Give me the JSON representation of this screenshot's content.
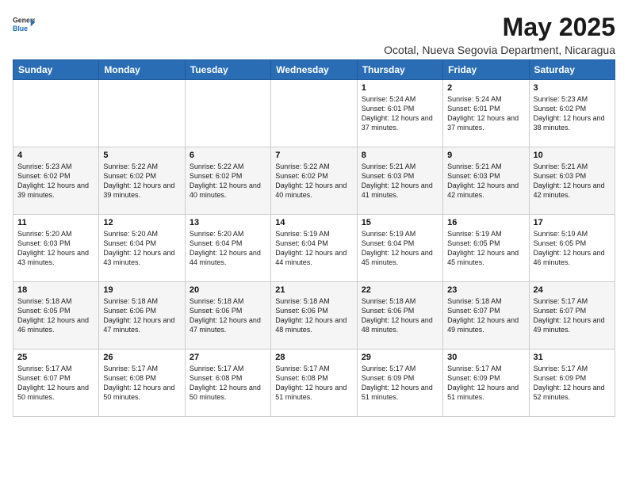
{
  "header": {
    "logo_general": "General",
    "logo_blue": "Blue",
    "title": "May 2025",
    "subtitle": "Ocotal, Nueva Segovia Department, Nicaragua"
  },
  "weekdays": [
    "Sunday",
    "Monday",
    "Tuesday",
    "Wednesday",
    "Thursday",
    "Friday",
    "Saturday"
  ],
  "weeks": [
    [
      {
        "day": "",
        "sunrise": "",
        "sunset": "",
        "daylight": ""
      },
      {
        "day": "",
        "sunrise": "",
        "sunset": "",
        "daylight": ""
      },
      {
        "day": "",
        "sunrise": "",
        "sunset": "",
        "daylight": ""
      },
      {
        "day": "",
        "sunrise": "",
        "sunset": "",
        "daylight": ""
      },
      {
        "day": "1",
        "sunrise": "Sunrise: 5:24 AM",
        "sunset": "Sunset: 6:01 PM",
        "daylight": "Daylight: 12 hours and 37 minutes."
      },
      {
        "day": "2",
        "sunrise": "Sunrise: 5:24 AM",
        "sunset": "Sunset: 6:01 PM",
        "daylight": "Daylight: 12 hours and 37 minutes."
      },
      {
        "day": "3",
        "sunrise": "Sunrise: 5:23 AM",
        "sunset": "Sunset: 6:02 PM",
        "daylight": "Daylight: 12 hours and 38 minutes."
      }
    ],
    [
      {
        "day": "4",
        "sunrise": "Sunrise: 5:23 AM",
        "sunset": "Sunset: 6:02 PM",
        "daylight": "Daylight: 12 hours and 39 minutes."
      },
      {
        "day": "5",
        "sunrise": "Sunrise: 5:22 AM",
        "sunset": "Sunset: 6:02 PM",
        "daylight": "Daylight: 12 hours and 39 minutes."
      },
      {
        "day": "6",
        "sunrise": "Sunrise: 5:22 AM",
        "sunset": "Sunset: 6:02 PM",
        "daylight": "Daylight: 12 hours and 40 minutes."
      },
      {
        "day": "7",
        "sunrise": "Sunrise: 5:22 AM",
        "sunset": "Sunset: 6:02 PM",
        "daylight": "Daylight: 12 hours and 40 minutes."
      },
      {
        "day": "8",
        "sunrise": "Sunrise: 5:21 AM",
        "sunset": "Sunset: 6:03 PM",
        "daylight": "Daylight: 12 hours and 41 minutes."
      },
      {
        "day": "9",
        "sunrise": "Sunrise: 5:21 AM",
        "sunset": "Sunset: 6:03 PM",
        "daylight": "Daylight: 12 hours and 42 minutes."
      },
      {
        "day": "10",
        "sunrise": "Sunrise: 5:21 AM",
        "sunset": "Sunset: 6:03 PM",
        "daylight": "Daylight: 12 hours and 42 minutes."
      }
    ],
    [
      {
        "day": "11",
        "sunrise": "Sunrise: 5:20 AM",
        "sunset": "Sunset: 6:03 PM",
        "daylight": "Daylight: 12 hours and 43 minutes."
      },
      {
        "day": "12",
        "sunrise": "Sunrise: 5:20 AM",
        "sunset": "Sunset: 6:04 PM",
        "daylight": "Daylight: 12 hours and 43 minutes."
      },
      {
        "day": "13",
        "sunrise": "Sunrise: 5:20 AM",
        "sunset": "Sunset: 6:04 PM",
        "daylight": "Daylight: 12 hours and 44 minutes."
      },
      {
        "day": "14",
        "sunrise": "Sunrise: 5:19 AM",
        "sunset": "Sunset: 6:04 PM",
        "daylight": "Daylight: 12 hours and 44 minutes."
      },
      {
        "day": "15",
        "sunrise": "Sunrise: 5:19 AM",
        "sunset": "Sunset: 6:04 PM",
        "daylight": "Daylight: 12 hours and 45 minutes."
      },
      {
        "day": "16",
        "sunrise": "Sunrise: 5:19 AM",
        "sunset": "Sunset: 6:05 PM",
        "daylight": "Daylight: 12 hours and 45 minutes."
      },
      {
        "day": "17",
        "sunrise": "Sunrise: 5:19 AM",
        "sunset": "Sunset: 6:05 PM",
        "daylight": "Daylight: 12 hours and 46 minutes."
      }
    ],
    [
      {
        "day": "18",
        "sunrise": "Sunrise: 5:18 AM",
        "sunset": "Sunset: 6:05 PM",
        "daylight": "Daylight: 12 hours and 46 minutes."
      },
      {
        "day": "19",
        "sunrise": "Sunrise: 5:18 AM",
        "sunset": "Sunset: 6:06 PM",
        "daylight": "Daylight: 12 hours and 47 minutes."
      },
      {
        "day": "20",
        "sunrise": "Sunrise: 5:18 AM",
        "sunset": "Sunset: 6:06 PM",
        "daylight": "Daylight: 12 hours and 47 minutes."
      },
      {
        "day": "21",
        "sunrise": "Sunrise: 5:18 AM",
        "sunset": "Sunset: 6:06 PM",
        "daylight": "Daylight: 12 hours and 48 minutes."
      },
      {
        "day": "22",
        "sunrise": "Sunrise: 5:18 AM",
        "sunset": "Sunset: 6:06 PM",
        "daylight": "Daylight: 12 hours and 48 minutes."
      },
      {
        "day": "23",
        "sunrise": "Sunrise: 5:18 AM",
        "sunset": "Sunset: 6:07 PM",
        "daylight": "Daylight: 12 hours and 49 minutes."
      },
      {
        "day": "24",
        "sunrise": "Sunrise: 5:17 AM",
        "sunset": "Sunset: 6:07 PM",
        "daylight": "Daylight: 12 hours and 49 minutes."
      }
    ],
    [
      {
        "day": "25",
        "sunrise": "Sunrise: 5:17 AM",
        "sunset": "Sunset: 6:07 PM",
        "daylight": "Daylight: 12 hours and 50 minutes."
      },
      {
        "day": "26",
        "sunrise": "Sunrise: 5:17 AM",
        "sunset": "Sunset: 6:08 PM",
        "daylight": "Daylight: 12 hours and 50 minutes."
      },
      {
        "day": "27",
        "sunrise": "Sunrise: 5:17 AM",
        "sunset": "Sunset: 6:08 PM",
        "daylight": "Daylight: 12 hours and 50 minutes."
      },
      {
        "day": "28",
        "sunrise": "Sunrise: 5:17 AM",
        "sunset": "Sunset: 6:08 PM",
        "daylight": "Daylight: 12 hours and 51 minutes."
      },
      {
        "day": "29",
        "sunrise": "Sunrise: 5:17 AM",
        "sunset": "Sunset: 6:09 PM",
        "daylight": "Daylight: 12 hours and 51 minutes."
      },
      {
        "day": "30",
        "sunrise": "Sunrise: 5:17 AM",
        "sunset": "Sunset: 6:09 PM",
        "daylight": "Daylight: 12 hours and 51 minutes."
      },
      {
        "day": "31",
        "sunrise": "Sunrise: 5:17 AM",
        "sunset": "Sunset: 6:09 PM",
        "daylight": "Daylight: 12 hours and 52 minutes."
      }
    ]
  ]
}
